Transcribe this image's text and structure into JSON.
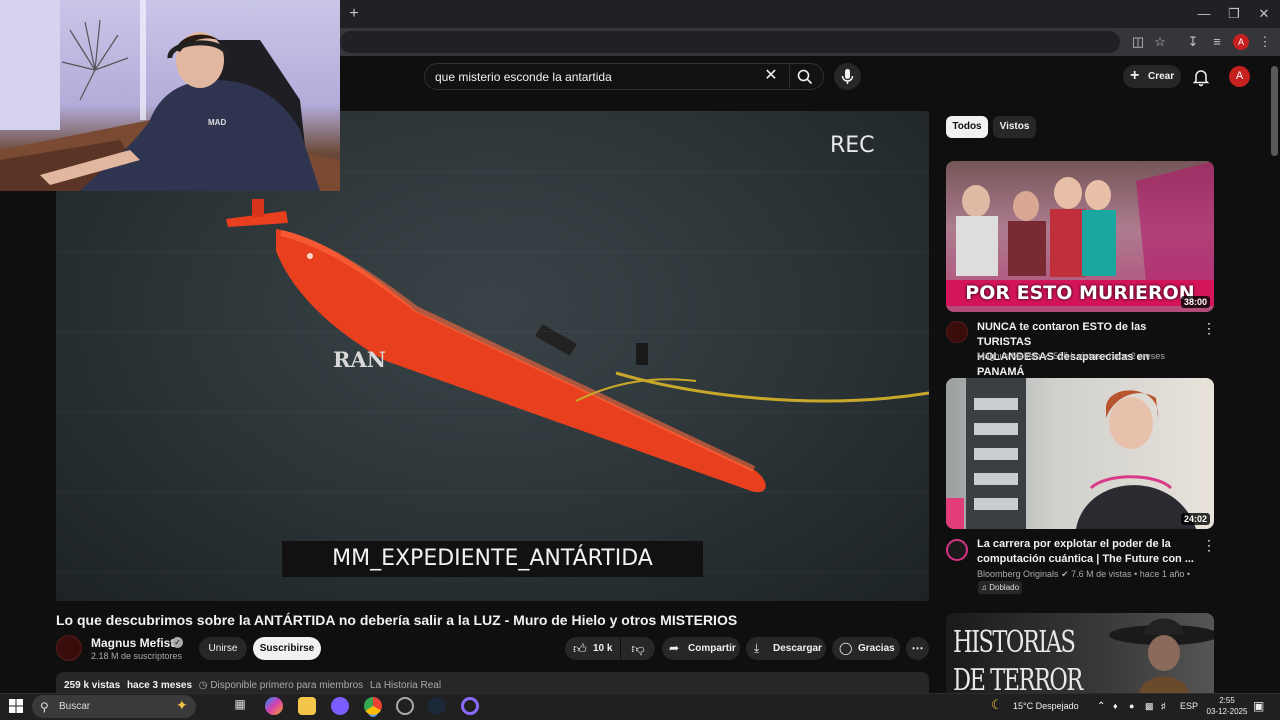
{
  "browser": {
    "new_tab_icon": "plus-icon",
    "window_buttons": [
      "minimize-icon",
      "restore-icon",
      "close-icon"
    ],
    "profile_initial": "A"
  },
  "header": {
    "search_value": "que misterio esconde la antartida",
    "create_label": "Crear",
    "avatar_initial": "A"
  },
  "video": {
    "rec_label": "REC",
    "ran_label": "RAN",
    "caption": "MM_EXPEDIENTE_ANTÁRTIDA",
    "title": "Lo que descubrimos sobre la ANTÁRTIDA no debería salir a la LUZ - Muro de Hielo y otros MISTERIOS",
    "channel": "Magnus Mefisto",
    "subscribers": "2.18 M de suscriptores",
    "join_label": "Unirse",
    "subscribe_label": "Suscribirse",
    "likes": "10 k",
    "share_label": "Compartir",
    "download_label": "Descargar",
    "thanks_label": "Gracias",
    "views": "259 k vistas",
    "age": "hace 3 meses",
    "members_note": "Disponible primero para miembros",
    "playlist_link": "La Historia Real"
  },
  "chips": [
    "Todos",
    "Vistos"
  ],
  "recommendations": [
    {
      "title_line1": "NUNCA te contaron ESTO de las TURISTAS",
      "title_line2": "HOLANDESAS desaparecidas en PANAMÁ",
      "thumb_text": "POR ESTO MURIERON",
      "duration": "38:00",
      "channel": "Magnus Mefisto",
      "meta": "565 k vistas • hace 2 meses"
    },
    {
      "title_line1": "La carrera por explotar el poder de la",
      "title_line2": "computación cuántica | The Future con ...",
      "duration": "24:02",
      "channel": "Bloomberg Originals",
      "meta": "7.6 M de vistas • hace 1 año •",
      "badge": "Doblado"
    },
    {
      "thumb_text_line1": "HISTORIAS",
      "thumb_text_line2": "DE TERROR"
    }
  ],
  "taskbar": {
    "search_label": "Buscar",
    "weather": "15°C  Despejado",
    "language": "ESP",
    "time": "2:55",
    "date": "03-12-2025"
  }
}
